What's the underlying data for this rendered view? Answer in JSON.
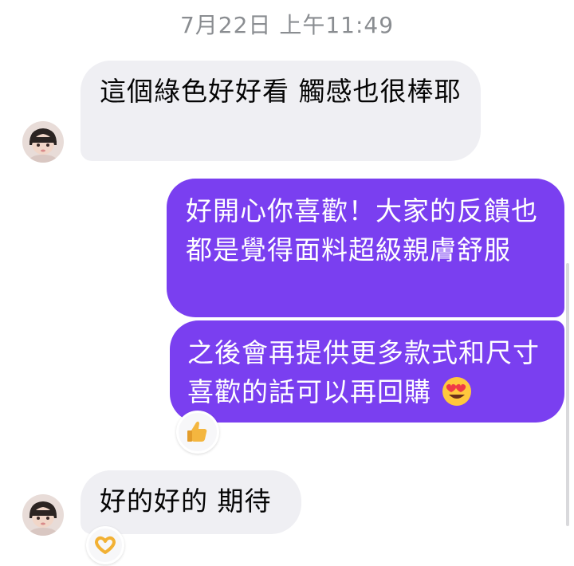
{
  "timestamp": "7月22日 上午11:49",
  "messages": [
    {
      "sender": "them",
      "text": "這個綠色好好看 觸感也很棒耶"
    },
    {
      "sender": "me",
      "text": "好開心你喜歡！大家的反饋也都是覺得面料超級親膚舒服"
    },
    {
      "sender": "me",
      "text": "之後會再提供更多款式和尺寸 喜歡的話可以再回購",
      "emoji": "smiling-face-with-heart-eyes",
      "reaction": "thumbs-up"
    },
    {
      "sender": "them",
      "text": "好的好的 期待",
      "reaction": "heart-hands"
    }
  ],
  "colors": {
    "incoming_bubble": "#efeff3",
    "outgoing_bubble": "#7a3ff0",
    "timestamp_text": "#8a8d91"
  }
}
